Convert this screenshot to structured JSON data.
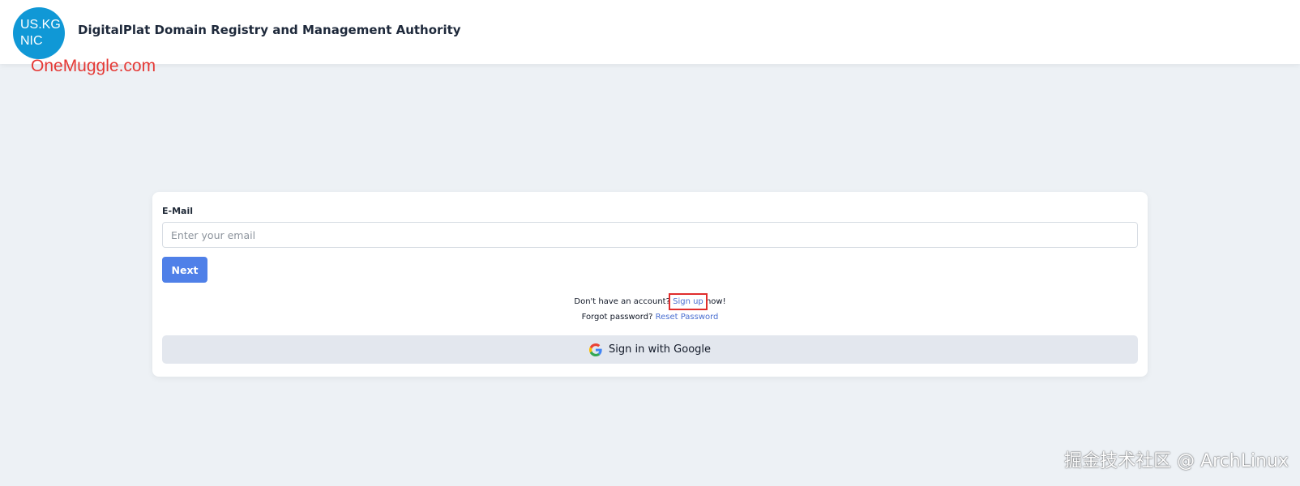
{
  "header": {
    "logo_line1": "US.KG",
    "logo_line2": "NIC",
    "title": "DigitalPlat Domain Registry and Management Authority",
    "brand_color": "#1098d6"
  },
  "watermarks": {
    "top_left": "OneMuggle.com",
    "bottom_right": "掘金技术社区 @ ArchLinux"
  },
  "login": {
    "email_label": "E-Mail",
    "email_value": "",
    "email_placeholder": "Enter your email",
    "next_label": "Next",
    "next_color": "#4f80e8",
    "signup_prefix": "Don't have an account? ",
    "signup_link": "Sign up",
    "signup_suffix": " now!",
    "forgot_prefix": "Forgot password? ",
    "reset_link": "Reset Password",
    "google_label": "Sign in with Google",
    "google_icon": "google-icon"
  }
}
